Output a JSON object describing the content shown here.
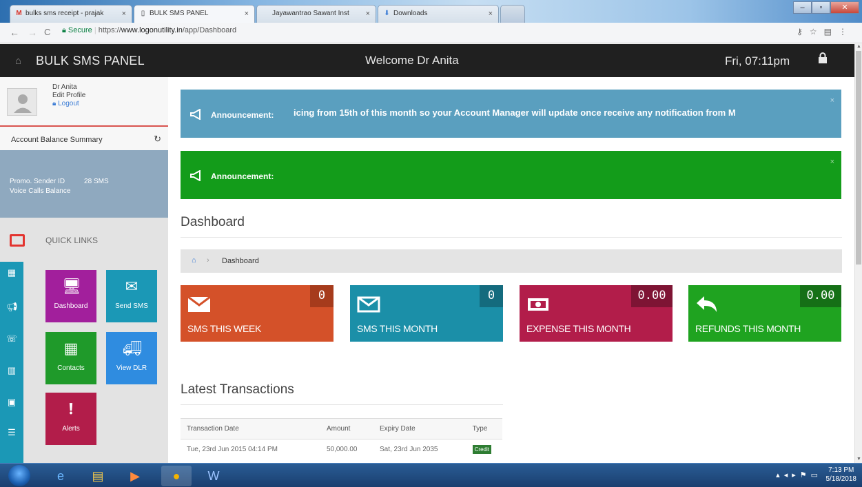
{
  "browser": {
    "tabs": [
      {
        "title": "bulks sms receipt - prajak",
        "icon": "gmail-icon"
      },
      {
        "title": "BULK SMS PANEL",
        "icon": "page-icon"
      },
      {
        "title": "Jayawantrao Sawant Inst",
        "icon": "page-icon"
      },
      {
        "title": "Downloads",
        "icon": "download-icon"
      }
    ],
    "secure_label": "Secure",
    "url_scheme": "https://",
    "url_domain": "www.logonutility.in",
    "url_path": "/app/Dashboard"
  },
  "header": {
    "brand": "BULK SMS PANEL",
    "welcome": "Welcome Dr Anita",
    "datetime": "Fri, 07:11pm"
  },
  "sidebar": {
    "user_name": "Dr Anita",
    "edit_profile": "Edit Profile",
    "logout": "Logout",
    "balance_title": "Account Balance Summary",
    "promo_label": "Promo. Sender ID",
    "promo_value": "28 SMS",
    "voice_label": "Voice Calls Balance",
    "quick_links": "QUICK LINKS",
    "tiles": [
      {
        "label": "Dashboard",
        "icon": "monitor-icon",
        "color": "#a21f9c"
      },
      {
        "label": "Send SMS",
        "icon": "envelope-icon",
        "color": "#1b98b6"
      },
      {
        "label": "Contacts",
        "icon": "table-icon",
        "color": "#1f9a2a"
      },
      {
        "label": "View DLR",
        "icon": "truck-icon",
        "color": "#2f8ce0"
      },
      {
        "label": "Alerts",
        "icon": "alert-icon",
        "color": "#b21d4a"
      }
    ],
    "side_icons": [
      "grid-icon",
      "megaphone-icon",
      "phone-icon",
      "chart-icon",
      "briefcase-icon",
      "list-icon"
    ]
  },
  "announcements": [
    {
      "label": "Announcement:",
      "message": "icing from 15th of this month so your Account Manager will update once receive any notification from M",
      "color": "#5a9fbf"
    },
    {
      "label": "Announcement:",
      "message": "",
      "color": "#139c1a"
    }
  ],
  "page": {
    "title": "Dashboard",
    "breadcrumb": "Dashboard",
    "latest_title": "Latest Transactions"
  },
  "stats": [
    {
      "label": "SMS THIS WEEK",
      "value": "0",
      "icon": "envelope-icon",
      "color": "#d45129",
      "num_color": "#a63b1c"
    },
    {
      "label": "SMS THIS MONTH",
      "value": "0",
      "icon": "envelope-outline-icon",
      "color": "#1b8fa8",
      "num_color": "#146b7e"
    },
    {
      "label": "EXPENSE THIS MONTH",
      "value": "0.00",
      "icon": "money-icon",
      "color": "#b21d4a",
      "num_color": "#7e1434"
    },
    {
      "label": "REFUNDS THIS MONTH",
      "value": "0.00",
      "icon": "reply-icon",
      "color": "#1fa320",
      "num_color": "#157016"
    }
  ],
  "transactions": {
    "headers": [
      "Transaction Date",
      "Amount",
      "Expiry Date",
      "Type"
    ],
    "rows": [
      {
        "date": "Tue, 23rd Jun 2015 04:14 PM",
        "amount": "50,000.00",
        "expiry": "Sat, 23rd Jun 2035",
        "type": "Credit"
      }
    ]
  },
  "taskbar": {
    "time": "7:13 PM",
    "date": "5/18/2018"
  }
}
